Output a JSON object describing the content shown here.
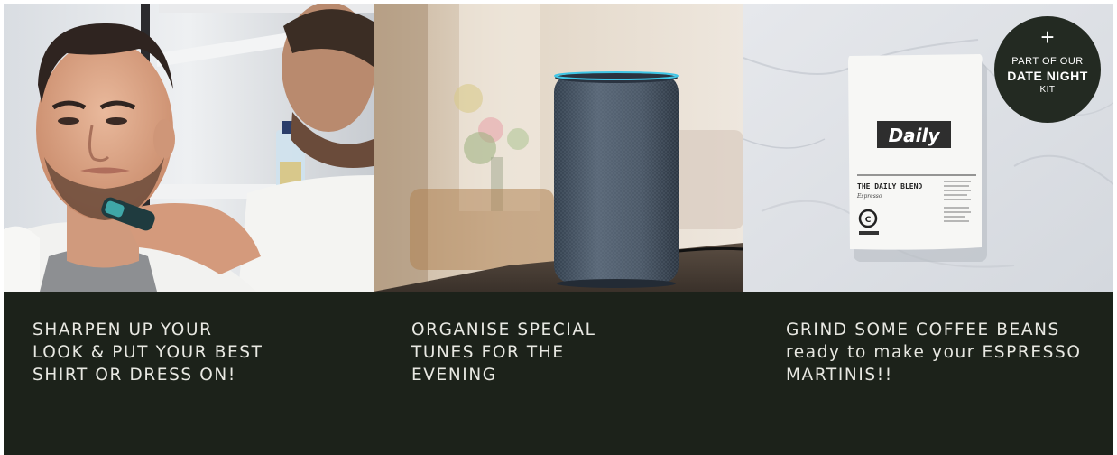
{
  "cards": [
    {
      "image_alt": "man shaving in mirror",
      "caption_lines": [
        "SHARPEN UP YOUR",
        "LOOK & PUT YOUR BEST",
        "SHIRT OR DRESS ON!"
      ]
    },
    {
      "image_alt": "smart speaker",
      "caption_lines": [
        "ORGANISE SPECIAL",
        "TUNES FOR THE",
        "EVENING"
      ]
    },
    {
      "image_alt": "coffee bag",
      "caption_lines": [
        "GRIND SOME COFFEE BEANS",
        "ready to make your ESPRESSO",
        "MARTINIS!!"
      ],
      "badge": {
        "plus": "+",
        "line1": "PART OF OUR",
        "line2": "DATE NIGHT",
        "line3": "KIT"
      },
      "bag": {
        "brand": "Daily",
        "product": "THE DAILY BLEND",
        "subtitle": "Espresso"
      }
    }
  ],
  "colors": {
    "caption_bg": "#1c221a",
    "caption_text": "#e8e8e2",
    "badge_bg": "#232a22"
  }
}
